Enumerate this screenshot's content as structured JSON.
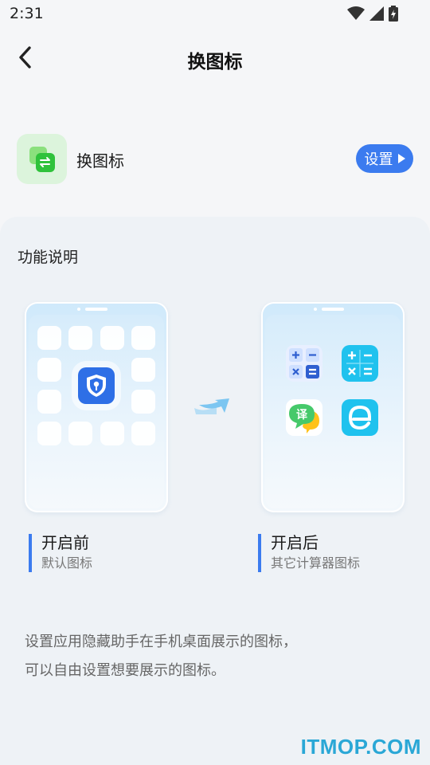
{
  "status_bar": {
    "time": "2:31",
    "icons": [
      "wifi-icon",
      "signal-icon",
      "battery-charging-icon"
    ]
  },
  "header": {
    "title": "换图标",
    "back_icon": "chevron-left-icon"
  },
  "feature": {
    "label": "换图标",
    "icon": "swap-icon",
    "button_label": "设置",
    "accent": "#3b7bef"
  },
  "description": {
    "section_title": "功能说明",
    "before": {
      "title": "开启前",
      "subtitle": "默认图标"
    },
    "after": {
      "title": "开启后",
      "subtitle": "其它计算器图标"
    },
    "after_icons": [
      "calculator-icon",
      "calculator-icon",
      "translate-icon",
      "browser-icon"
    ],
    "translate_glyph": "译",
    "lines": [
      "设置应用隐藏助手在手机桌面展示的图标，",
      "可以自由设置想要展示的图标。"
    ]
  },
  "watermark": "ITMOP.COM"
}
